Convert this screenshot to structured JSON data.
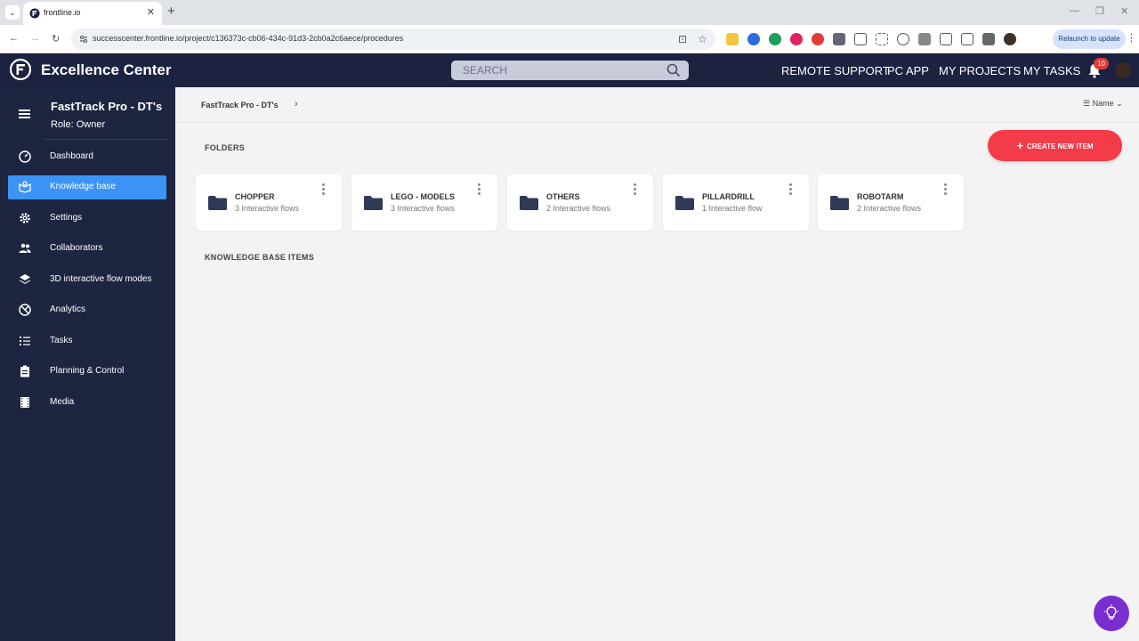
{
  "browser": {
    "tab_title": "frontline.io",
    "url": "successcenter.frontline.io/project/c136373c-cb06-434c-91d3-2cb0a2c6aece/procedures",
    "relaunch_label": "Relaunch to update"
  },
  "header": {
    "app_title": "Excellence Center",
    "search_placeholder": "SEARCH",
    "nav": [
      "REMOTE SUPPORT",
      "PC APP",
      "MY PROJECTS",
      "MY TASKS"
    ],
    "notification_count": "10"
  },
  "sidebar": {
    "project_name": "FastTrack Pro - DT's",
    "role": "Role: Owner",
    "items": [
      {
        "label": "Dashboard",
        "icon": "dashboard-icon",
        "active": false
      },
      {
        "label": "Knowledge base",
        "icon": "knowledge-base-icon",
        "active": true
      },
      {
        "label": "Settings",
        "icon": "settings-icon",
        "active": false
      },
      {
        "label": "Collaborators",
        "icon": "collaborators-icon",
        "active": false
      },
      {
        "label": "3D interactive flow modes",
        "icon": "layers-icon",
        "active": false
      },
      {
        "label": "Analytics",
        "icon": "analytics-icon",
        "active": false
      },
      {
        "label": "Tasks",
        "icon": "tasks-icon",
        "active": false
      },
      {
        "label": "Planning & Control",
        "icon": "clipboard-icon",
        "active": false
      },
      {
        "label": "Media",
        "icon": "film-icon",
        "active": false
      }
    ]
  },
  "main": {
    "breadcrumb": "FastTrack Pro - DT's",
    "sort_label": "Name",
    "folders_title": "FOLDERS",
    "create_label": "CREATE NEW ITEM",
    "kb_items_title": "KNOWLEDGE BASE ITEMS",
    "folders": [
      {
        "name": "CHOPPER",
        "count": "3 Interactive flows"
      },
      {
        "name": "LEGO - MODELS",
        "count": "3 Interactive flows"
      },
      {
        "name": "OTHERS",
        "count": "2 Interactive flows"
      },
      {
        "name": "PILLARDRILL",
        "count": "1 Interactive flow"
      },
      {
        "name": "ROBOTARM",
        "count": "2 Interactive flows"
      }
    ]
  },
  "colors": {
    "header_bg": "#1c2240",
    "sidebar_bg": "#1d2540",
    "active_item": "#3b94f5",
    "create_button": "#f33b4a",
    "fab": "#7a2ed0"
  }
}
